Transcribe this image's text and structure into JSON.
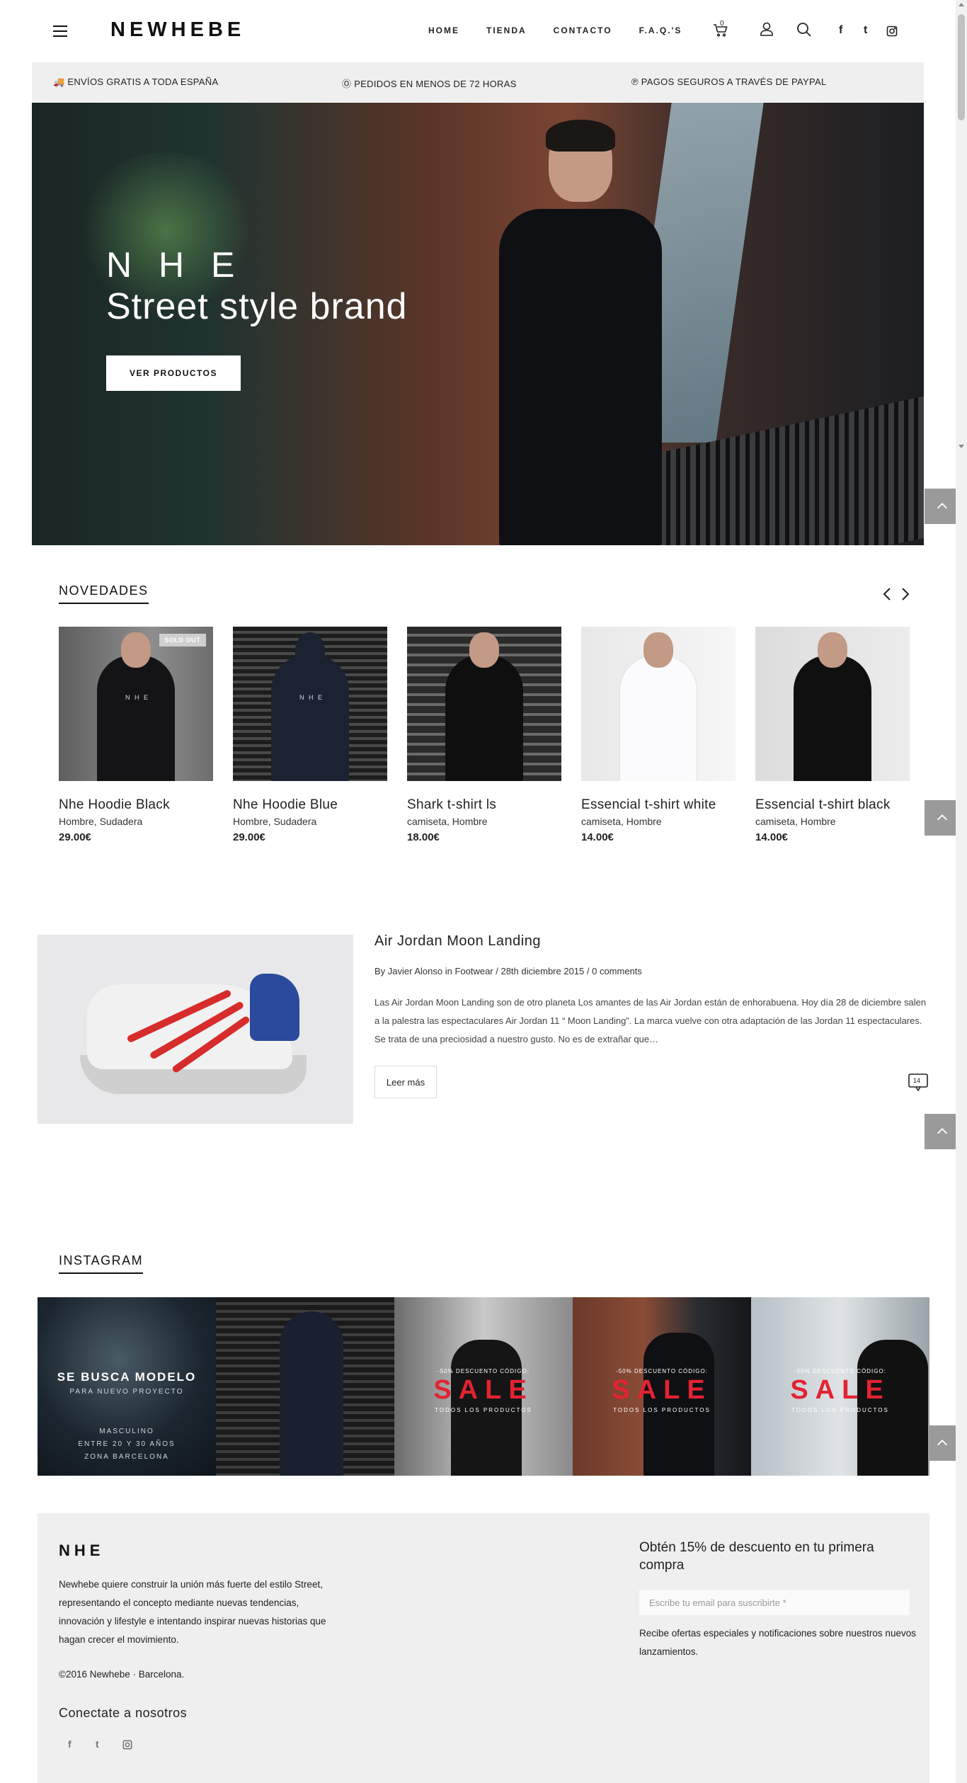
{
  "header": {
    "logo": "NEWHEBE",
    "nav": [
      "HOME",
      "TIENDA",
      "CONTACTO",
      "F.A.Q.'S"
    ],
    "cart_count": "0",
    "social": [
      "f",
      "t",
      "instagram-icon"
    ]
  },
  "shipbar": {
    "items": [
      "🚚 ENVÍOS GRATIS A TODA ESPAÑA",
      "Ⓞ PEDIDOS EN MENOS DE 72 HORAS",
      "℗ PAGOS SEGUROS A TRAVÉS DE PAYPAL"
    ]
  },
  "hero": {
    "title_line1": "N H E",
    "title_line2": "Street style brand",
    "button": "VER PRODUCTOS"
  },
  "novedades": {
    "title": "NOVEDADES",
    "products": [
      {
        "name": "Nhe Hoodie Black",
        "categories": "Hombre, Sudadera",
        "price": "29.00€",
        "badge": "SOLD OUT"
      },
      {
        "name": "Nhe Hoodie Blue",
        "categories": "Hombre, Sudadera",
        "price": "29.00€",
        "badge": ""
      },
      {
        "name": "Shark t-shirt ls",
        "categories": "camiseta, Hombre",
        "price": "18.00€",
        "badge": ""
      },
      {
        "name": "Essencial t-shirt white",
        "categories": "camiseta, Hombre",
        "price": "14.00€",
        "badge": ""
      },
      {
        "name": "Essencial t-shirt black",
        "categories": "camiseta, Hombre",
        "price": "14.00€",
        "badge": ""
      }
    ]
  },
  "blog": {
    "title": "Air Jordan Moon Landing",
    "meta": "By Javier Alonso in Footwear / 28th diciembre 2015 / 0 comments",
    "excerpt": "Las Air Jordan Moon Landing son de otro planeta Los amantes de las Air Jordan están de enhorabuena. Hoy día 28 de diciembre salen a la palestra las espectaculares Air Jordan 11 “ Moon Landing”. La marca vuelve con otra adaptación de las Jordan 11 espectaculares. Se trata de una preciosidad a nuestro gusto. No es de extrañar que…",
    "read_more": "Leer más",
    "comment_count": "14"
  },
  "instagram": {
    "title": "INSTAGRAM",
    "tile1": {
      "line1": "SE BUSCA MODELO",
      "line2": "PARA NUEVO PROYECTO",
      "line3": "MASCULINO",
      "line4": "ENTRE 20 Y 30 AÑOS",
      "line5": "ZONA BARCELONA"
    },
    "sale": {
      "top": "-50% DESCUENTO CÓDIGO:",
      "word": "SALE",
      "bottom": "TODOS LOS PRODUCTOS"
    }
  },
  "footer": {
    "logo": "NHE",
    "about": "Newhebe quiere construir la unión más fuerte del estilo Street, representando el concepto mediante nuevas tendencias, innovación y lifestyle e intentando inspirar nuevas historias que hagan crecer el movimiento.",
    "copyright": "©2016 Newhebe · Barcelona.",
    "connect": "Conectate a nosotros",
    "social": [
      "f",
      "t"
    ],
    "offer": "Obtén 15% de descuento en tu primera compra",
    "email_placeholder": "Escribe tu email para suscribirte *",
    "note": "Recibe ofertas especiales y notificaciones sobre nuestros nuevos lanzamientos."
  },
  "colors": {
    "sale_red": "#e32331",
    "shipbar_bg": "#efefef",
    "up_button": "#9a9a9a"
  }
}
